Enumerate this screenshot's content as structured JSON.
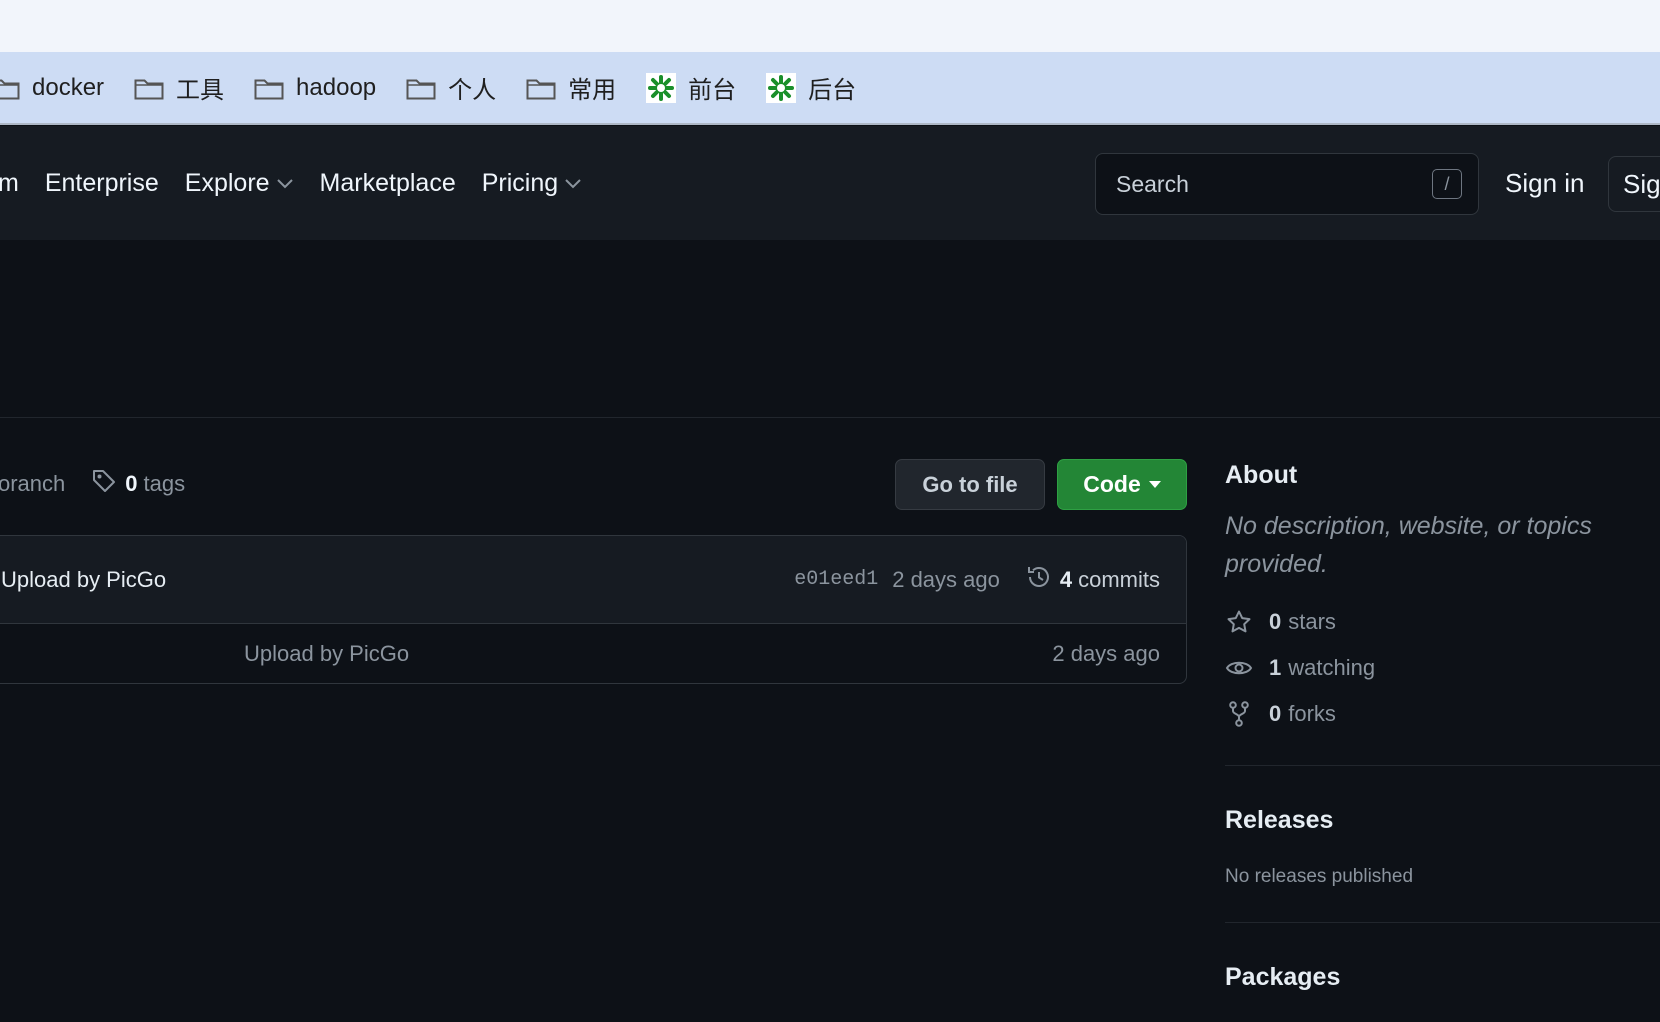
{
  "bookmarks": [
    {
      "label": "docker",
      "icon": "folder-icon"
    },
    {
      "label": "工具",
      "icon": "folder-icon"
    },
    {
      "label": "hadoop",
      "icon": "folder-icon"
    },
    {
      "label": "个人",
      "icon": "folder-icon"
    },
    {
      "label": "常用",
      "icon": "folder-icon"
    },
    {
      "label": "前台",
      "icon": "green-asterisk-icon"
    },
    {
      "label": "后台",
      "icon": "green-asterisk-icon"
    }
  ],
  "nav": {
    "partial_item": "m",
    "items": [
      "Enterprise",
      "Explore",
      "Marketplace",
      "Pricing"
    ]
  },
  "search": {
    "placeholder": "Search",
    "shortcut": "/"
  },
  "auth": {
    "sign_in": "Sign in",
    "sign_up_partial": "Sig"
  },
  "repo": {
    "branch_partial": "oranch",
    "tags_count": "0",
    "tags_label": "tags",
    "go_to_file": "Go to file",
    "code": "Code",
    "latest_commit": {
      "message": "Upload by PicGo",
      "sha": "e01eed1",
      "time": "2 days ago",
      "commits_count": "4",
      "commits_label": "commits"
    },
    "files": [
      {
        "message": "Upload by PicGo",
        "time": "2 days ago"
      }
    ]
  },
  "sidebar": {
    "about_title": "About",
    "about_desc": "No description, website, or topics provided.",
    "stats": [
      {
        "icon": "star-icon",
        "count": "0",
        "label": "stars"
      },
      {
        "icon": "eye-icon",
        "count": "1",
        "label": "watching"
      },
      {
        "icon": "fork-icon",
        "count": "0",
        "label": "forks"
      }
    ],
    "releases_title": "Releases",
    "releases_empty": "No releases published",
    "packages_title": "Packages"
  },
  "colors": {
    "bg": "#0d1117",
    "header_bg": "#161b22",
    "code_button": "#238636",
    "bookmark_bar": "#cddcf4"
  }
}
